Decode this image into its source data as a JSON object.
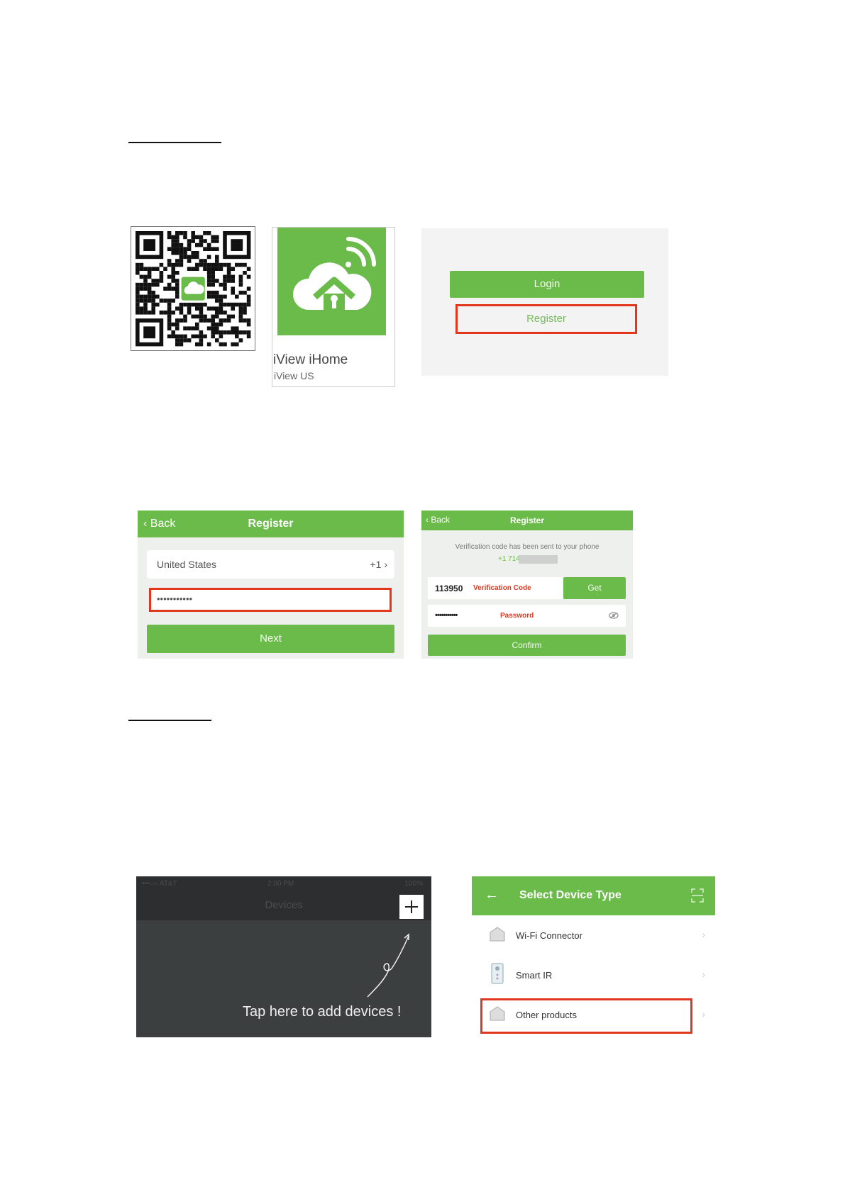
{
  "app_store": {
    "app_name": "iView iHome",
    "app_region": "iView US"
  },
  "login_screen": {
    "login_label": "Login",
    "register_label": "Register"
  },
  "register_screen": {
    "back_label": "Back",
    "title": "Register",
    "country": "United States",
    "country_code": "+1",
    "phone_value": "•••••••••••",
    "next_label": "Next"
  },
  "verify_screen": {
    "back_label": "Back",
    "title": "Register",
    "info_text": "Verification code has been sent to your phone",
    "phone_prefix": "+1 714",
    "code_value": "113950",
    "code_label": "Verification Code",
    "get_label": "Get",
    "password_value": "•••••••••••",
    "password_label": "Password",
    "confirm_label": "Confirm"
  },
  "devices_screen": {
    "status_carrier": "•••○○ AT&T",
    "status_time": "2:50 PM",
    "status_battery": "100%",
    "title": "Devices",
    "hint": "Tap here to add devices !"
  },
  "select_screen": {
    "title": "Select Device Type",
    "items": [
      {
        "label": "Wi-Fi Connector"
      },
      {
        "label": "Smart IR"
      },
      {
        "label": "Other products"
      }
    ]
  },
  "colors": {
    "brand_green": "#6bbb4b",
    "highlight_red": "#e0371e"
  }
}
